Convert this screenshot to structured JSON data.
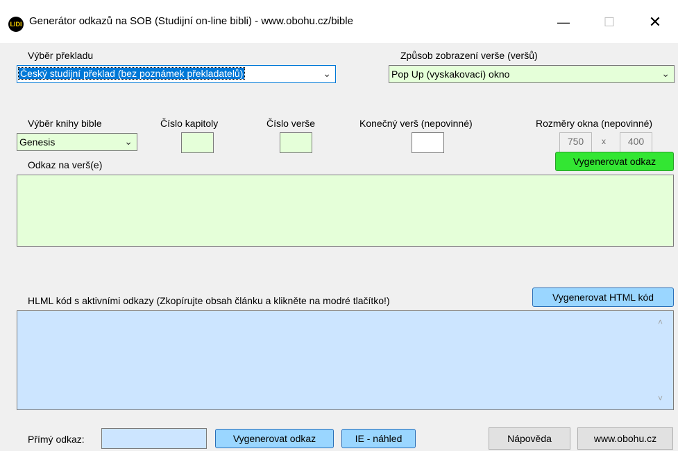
{
  "window": {
    "title": "Generátor odkazů na SOB (Studijní on-line bibli) - www.obohu.cz/bible",
    "icon_text": "LIDI",
    "minimize_glyph": "—",
    "maximize_glyph": "☐",
    "close_glyph": "✕"
  },
  "translation": {
    "label": "Výběr překladu",
    "selected": "Český studijní překlad (bez poznámek překladatelů)"
  },
  "display_mode": {
    "label": "Způsob zobrazení verše (veršů)",
    "selected": "Pop Up (vyskakovací) okno"
  },
  "book": {
    "label": "Výběr knihy bible",
    "selected": "Genesis"
  },
  "chapter": {
    "label": "Číslo kapitoly",
    "value": ""
  },
  "verse": {
    "label": "Číslo verše",
    "value": ""
  },
  "end_verse": {
    "label": "Konečný verš (nepovinné)",
    "value": ""
  },
  "window_size": {
    "label": "Rozměry okna (nepovinné)",
    "width": "750",
    "separator": "x",
    "height": "400"
  },
  "verse_link": {
    "label": "Odkaz na verš(e)",
    "button": "Vygenerovat odkaz",
    "value": ""
  },
  "html_code": {
    "label": "HLML kód s aktivními odkazy (Zkopírujte obsah článku a klikněte na modré tlačítko!)",
    "button": "Vygenerovat HTML kód",
    "value": "",
    "scroll_up_glyph": "˄",
    "scroll_down_glyph": "˅"
  },
  "bottom": {
    "direct_link_label": "Přímý odkaz:",
    "direct_link_value": "",
    "generate_button": "Vygenerovat odkaz",
    "preview_button": "IE - náhled",
    "help_button": "Nápověda",
    "site_button": "www.obohu.cz"
  },
  "colors": {
    "input_green": "#e5ffd9",
    "input_blue": "#cce5ff",
    "button_green": "#33e633",
    "button_blue": "#9ad6ff",
    "selection_blue": "#0078d7"
  }
}
